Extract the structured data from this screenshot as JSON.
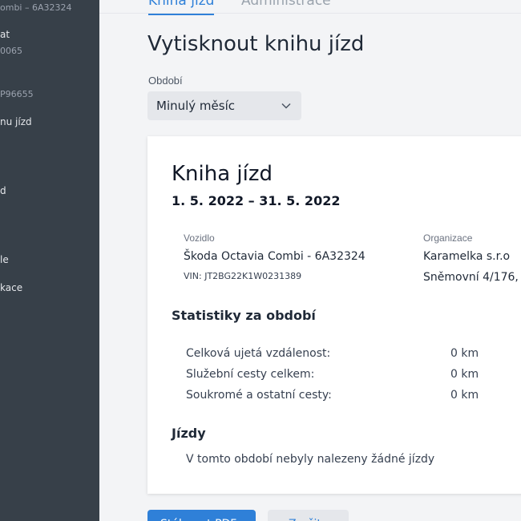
{
  "sidebar": {
    "items": [
      {
        "label": "ombi  –  6A32324",
        "dim": true
      },
      {
        "label": "at",
        "dim": false
      },
      {
        "label": "0065",
        "dim": true
      },
      {
        "label": "P96655",
        "dim": true
      },
      {
        "label": "nu jízd",
        "dim": false
      },
      {
        "label": "d",
        "dim": false
      },
      {
        "label": "le",
        "dim": false
      },
      {
        "label": "kace",
        "dim": false
      }
    ]
  },
  "tabs": {
    "active": "Kniha jízd",
    "inactive": "Administrace"
  },
  "page": {
    "title": "Vytisknout knihu jízd",
    "period_label": "Období",
    "period_value": "Minulý měsíc"
  },
  "report": {
    "title": "Kniha jízd",
    "date_range": "1. 5. 2022 – 31. 5. 2022",
    "vehicle_label": "Vozidlo",
    "vehicle_name": "Škoda Octavia Combi - 6A32324",
    "vin": "VIN: JT2BG22K1W0231389",
    "org_label": "Organizace",
    "org_name": "Karamelka s.r.o",
    "org_address": "Sněmovní 4/176,",
    "stats_heading": "Statistiky za období",
    "stats": [
      {
        "label": "Celková ujetá vzdálenost:",
        "value": "0 km"
      },
      {
        "label": "Služební cesty celkem:",
        "value": "0 km"
      },
      {
        "label": "Soukromé a ostatní cesty:",
        "value": "0 km"
      }
    ],
    "rides_heading": "Jízdy",
    "rides_empty": "V tomto období nebyly nalezeny žádné jízdy"
  },
  "buttons": {
    "primary": "Stáhnout PDF",
    "secondary": "Zrušit"
  },
  "colors": {
    "accent": "#2f80d8",
    "sidebar_bg": "#374049"
  }
}
